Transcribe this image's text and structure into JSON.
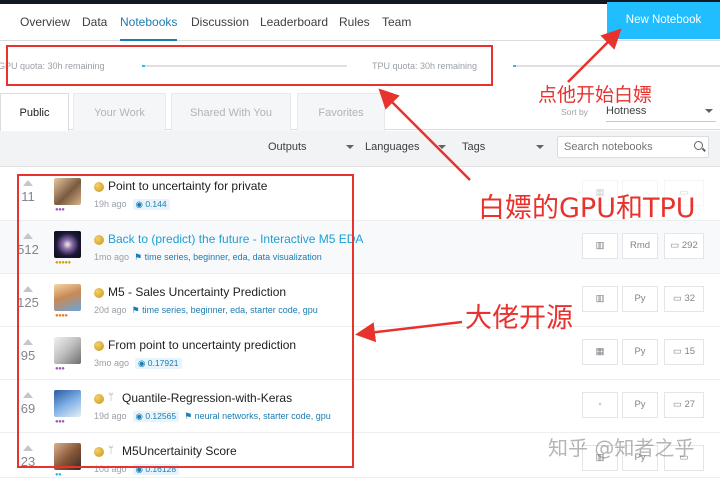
{
  "nav": {
    "tabs": [
      "Overview",
      "Data",
      "Notebooks",
      "Discussion",
      "Leaderboard",
      "Rules",
      "Team"
    ],
    "active": "Notebooks",
    "new_notebook": "New Notebook"
  },
  "quota": {
    "gpu": {
      "label": "GPU quota: 30h remaining",
      "used_fraction": 0.01
    },
    "tpu": {
      "label": "TPU quota: 30h remaining",
      "used_fraction": 0.01
    }
  },
  "filter_tabs": [
    "Public",
    "Your Work",
    "Shared With You",
    "Favorites"
  ],
  "sort": {
    "label": "Sort by",
    "value": "Hotness"
  },
  "filters": {
    "outputs": "Outputs",
    "languages": "Languages",
    "tags": "Tags",
    "search_placeholder": "Search notebooks"
  },
  "notebooks": [
    {
      "votes": "11",
      "title": "Point to uncertainty for private",
      "age": "19h ago",
      "score": "0.144",
      "tags": "",
      "lang": "",
      "comments": ""
    },
    {
      "votes": "512",
      "title": "Back to (predict) the future - Interactive M5 EDA",
      "age": "1mo ago",
      "score": "",
      "tags": "time series, beginner, eda, data visualization",
      "lang": "Rmd",
      "comments": "292"
    },
    {
      "votes": "125",
      "title": "M5 - Sales Uncertainty Prediction",
      "age": "20d ago",
      "score": "",
      "tags": "time series, beginner, eda, starter code, gpu",
      "lang": "Py",
      "comments": "32"
    },
    {
      "votes": "95",
      "title": "From point to uncertainty prediction",
      "age": "3mo ago",
      "score": "0.17921",
      "tags": "",
      "lang": "Py",
      "comments": "15"
    },
    {
      "votes": "69",
      "title": "Quantile-Regression-with-Keras",
      "age": "19d ago",
      "score": "0.12565",
      "tags": "neural networks, starter code, gpu",
      "lang": "Py",
      "comments": "27"
    },
    {
      "votes": "23",
      "title": "M5Uncertainity Score",
      "age": "10d ago",
      "score": "0.16128",
      "tags": "",
      "lang": "Py",
      "comments": ""
    }
  ],
  "annotations": {
    "click_here": "点他开始白嫖",
    "free_gpu_tpu": "白嫖的GPU和TPU",
    "open_source": "大佬开源"
  },
  "watermark": "知乎 @知者之乎",
  "colors": {
    "accent": "#20beff",
    "link": "#1a7db3",
    "annotation": "#e8322d"
  }
}
